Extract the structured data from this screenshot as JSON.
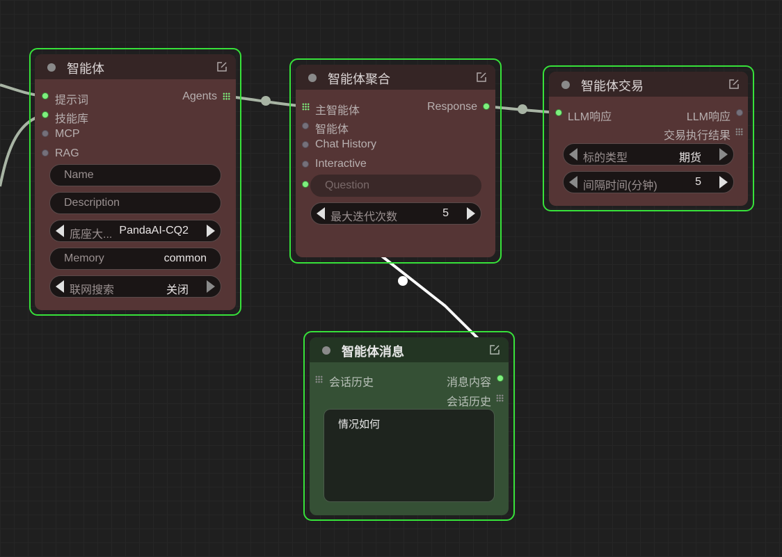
{
  "colors": {
    "selection": "#37e23a",
    "node_red": "#553535",
    "node_green": "#355035",
    "wire": "#a8b4a4",
    "wire_active": "#ffffff"
  },
  "nodes": {
    "agent": {
      "title": "智能体",
      "inputs": [
        "提示词",
        "技能库",
        "MCP",
        "RAG"
      ],
      "output": "Agents",
      "name_placeholder": "Name",
      "description_placeholder": "Description",
      "base_model_label": "底座大...",
      "base_model_value": "PandaAI-CQ2",
      "memory_label": "Memory",
      "memory_value": "common",
      "web_search_label": "联网搜索",
      "web_search_value": "关闭"
    },
    "aggregate": {
      "title": "智能体聚合",
      "inputs": [
        "主智能体",
        "智能体",
        "Chat History",
        "Interactive"
      ],
      "output": "Response",
      "question_placeholder": "Question",
      "max_iter_label": "最大迭代次数",
      "max_iter_value": "5"
    },
    "trade": {
      "title": "智能体交易",
      "input": "LLM响应",
      "outputs": [
        "LLM响应",
        "交易执行结果"
      ],
      "asset_type_label": "标的类型",
      "asset_type_value": "期货",
      "interval_label": "间隔时间(分钟)",
      "interval_value": "5"
    },
    "message": {
      "title": "智能体消息",
      "input": "会话历史",
      "outputs": [
        "消息内容",
        "会话历史"
      ],
      "content": "情况如何"
    }
  }
}
